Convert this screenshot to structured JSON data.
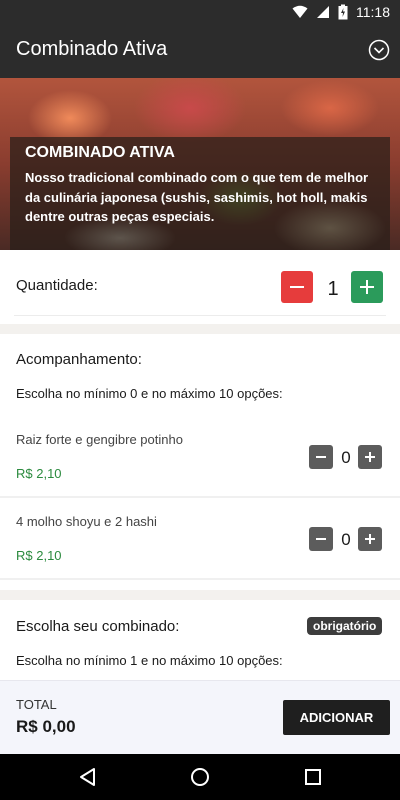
{
  "status_bar": {
    "time": "11:18"
  },
  "app_bar": {
    "title": "Combinado Ativa"
  },
  "hero": {
    "title": "COMBINADO ATIVA",
    "description": "Nosso tradicional combinado com o que tem de melhor da culinária japonesa (sushis, sashimis, hot holl, makis dentre outras peças especiais."
  },
  "quantity": {
    "label": "Quantidade:",
    "value": "1"
  },
  "accompaniment": {
    "title": "Acompanhamento:",
    "hint": "Escolha no mínimo 0 e no máximo 10 opções:",
    "items": [
      {
        "name": "Raiz forte e gengibre potinho",
        "price": "R$ 2,10",
        "count": "0"
      },
      {
        "name": "4 molho shoyu e 2 hashi",
        "price": "R$ 2,10",
        "count": "0"
      }
    ]
  },
  "combo_choice": {
    "title": "Escolha seu combinado:",
    "badge": "obrigatório",
    "hint": "Escolha no mínimo 1 e no máximo 10 opções:"
  },
  "footer": {
    "total_label": "TOTAL",
    "total_value": "R$ 0,00",
    "add_button": "ADICIONAR"
  },
  "colors": {
    "accent_red": "#e63c3c",
    "accent_green": "#2b9b5b",
    "price_green": "#2b8a3e",
    "dark": "#2c2c2c"
  }
}
